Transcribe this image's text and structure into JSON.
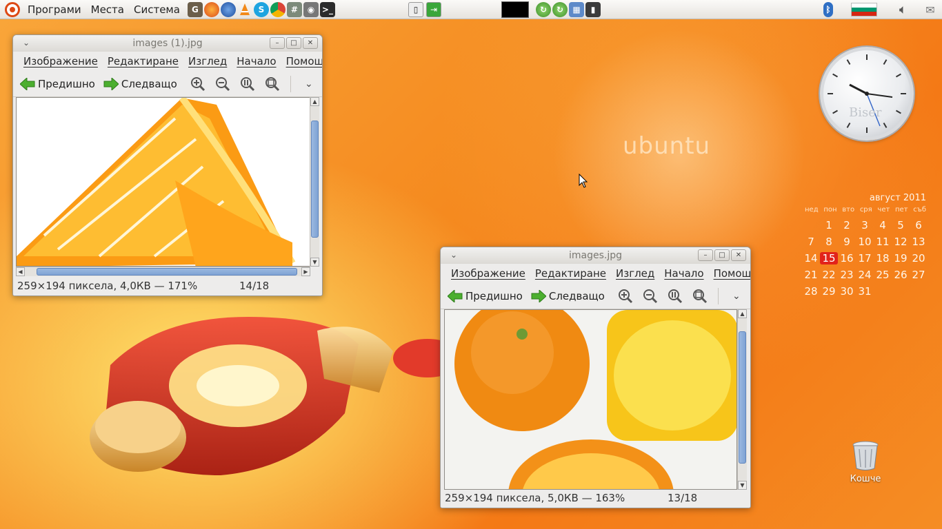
{
  "top_panel": {
    "menus": [
      "Програми",
      "Места",
      "Система"
    ]
  },
  "desktop": {
    "ubuntu_text": "ubuntu",
    "clock_label": "Biser",
    "trash_label": "Кошче"
  },
  "calendar": {
    "title": "август 2011",
    "weekdays": [
      "нед",
      "пон",
      "вто",
      "сря",
      "чет",
      "пет",
      "съб"
    ],
    "today": "15"
  },
  "window1": {
    "title": "images (1).jpg",
    "menu": [
      "Изображение",
      "Редактиране",
      "Изглед",
      "Начало",
      "Помощ"
    ],
    "prev_label": "Предишно",
    "next_label": "Следващо",
    "status_info": "259×194 пиксела, 4,0КВ — 171%",
    "status_counter": "14/18"
  },
  "window2": {
    "title": "images.jpg",
    "menu": [
      "Изображение",
      "Редактиране",
      "Изглед",
      "Начало",
      "Помощ"
    ],
    "prev_label": "Предишно",
    "next_label": "Следващо",
    "status_info": "259×194 пиксела, 5,0КВ — 163%",
    "status_counter": "13/18"
  },
  "colors": {
    "accent": "#f47916",
    "today_highlight": "#e2231a",
    "scroll_thumb": "#7fa3d4"
  }
}
